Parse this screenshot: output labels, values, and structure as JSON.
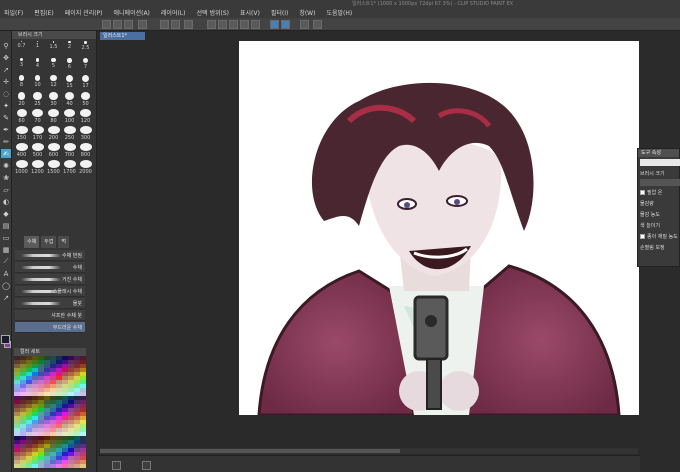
{
  "window": {
    "title": "일러스트1* (1000 x 1000px 72dpi 67.3%) - CLIP STUDIO PAINT EX"
  },
  "menu": [
    "파일(F)",
    "편집(E)",
    "페이지 관리(P)",
    "애니메이션(A)",
    "레이어(L)",
    "선택 범위(S)",
    "표시(V)",
    "필터(I)",
    "창(W)",
    "도움말(H)"
  ],
  "document_tab": "일러스트1*",
  "brush_panel": {
    "title": "브러시 크기",
    "sizes": [
      "0.7",
      "1",
      "1.5",
      "2",
      "2.5",
      "3",
      "4",
      "5",
      "6",
      "7",
      "8",
      "10",
      "12",
      "15",
      "17",
      "20",
      "25",
      "30",
      "40",
      "50",
      "60",
      "70",
      "80",
      "100",
      "120",
      "150",
      "170",
      "200",
      "250",
      "300",
      "400",
      "500",
      "600",
      "700",
      "800",
      "1000",
      "1200",
      "1500",
      "1700",
      "2000"
    ]
  },
  "subtool_panel": {
    "tabs": [
      "수채",
      "두껍",
      "먹"
    ],
    "items": [
      "수채 번짐",
      "수채",
      "거친 수채",
      "스플래시 수채",
      "물붓",
      "샤프한 수채 붓",
      "부드러운 수채"
    ]
  },
  "color_set_title": "컬러 세트",
  "tool_property": {
    "title": "도구 속성",
    "rows": [
      "브러시 크기",
      "필압 온",
      "물감량",
      "물감 농도",
      "색 늘이기",
      "종이 재질 농도",
      "손떨림 보정"
    ]
  },
  "colors": {
    "accent": "#4aa3c8",
    "canvas": "#ffffff",
    "ui_dark": "#353535",
    "main_color": "#1a1a2a",
    "sub_color": "#8a3fa8"
  },
  "icons": {
    "toolbar": [
      "new-icon",
      "open-icon",
      "save-icon",
      "undo-icon",
      "redo-icon",
      "clear-icon",
      "transform-icon",
      "snap-icon",
      "ruler-icon"
    ]
  }
}
